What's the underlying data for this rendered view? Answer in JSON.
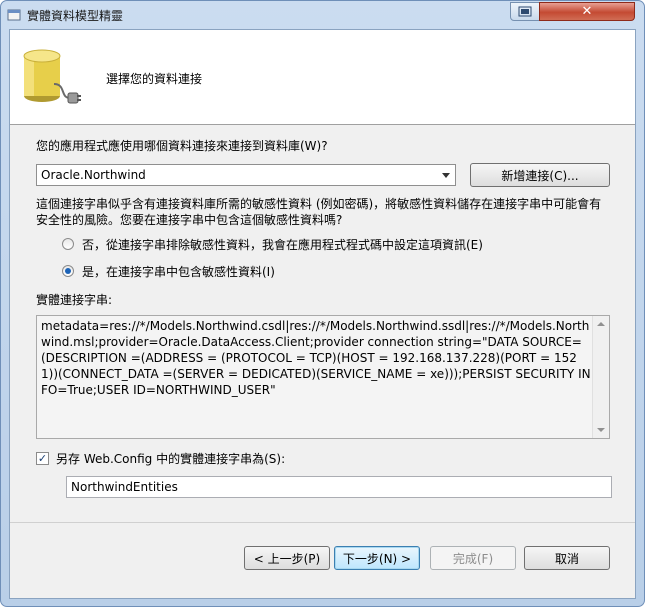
{
  "window": {
    "title": "實體資料模型精靈",
    "help_icon": "window-help-icon",
    "close_icon": "window-close-icon"
  },
  "header": {
    "title": "選擇您的資料連接",
    "icon": "database-plug-icon"
  },
  "connection": {
    "question": "您的應用程式應使用哪個資料連接來連接到資料庫(W)?",
    "selected": "Oracle.Northwind",
    "new_button": "新增連接(C)..."
  },
  "sensitivity": {
    "warning": "這個連接字串似乎含有連接資料庫所需的敏感性資料 (例如密碼)，將敏感性資料儲存在連接字串中可能會有安全性的風險。您要在連接字串中包含這個敏感性資料嗎?",
    "option_exclude": "否，從連接字串排除敏感性資料，我會在應用程式程式碼中設定這項資訊(E)",
    "option_include": "是，在連接字串中包含敏感性資料(I)",
    "selected": "include"
  },
  "entity_connection": {
    "label": "實體連接字串:",
    "value": "metadata=res://*/Models.Northwind.csdl|res://*/Models.Northwind.ssdl|res://*/Models.Northwind.msl;provider=Oracle.DataAccess.Client;provider connection string=\"DATA SOURCE=(DESCRIPTION =(ADDRESS = (PROTOCOL = TCP)(HOST = 192.168.137.228)(PORT = 1521))(CONNECT_DATA =(SERVER = DEDICATED)(SERVICE_NAME = xe)));PERSIST SECURITY INFO=True;USER ID=NORTHWIND_USER\""
  },
  "save": {
    "checked": true,
    "label": "另存 Web.Config 中的實體連接字串為(S):",
    "name": "NorthwindEntities"
  },
  "buttons": {
    "back": "< 上一步(P)",
    "next": "下一步(N) >",
    "finish": "完成(F)",
    "cancel": "取消"
  }
}
